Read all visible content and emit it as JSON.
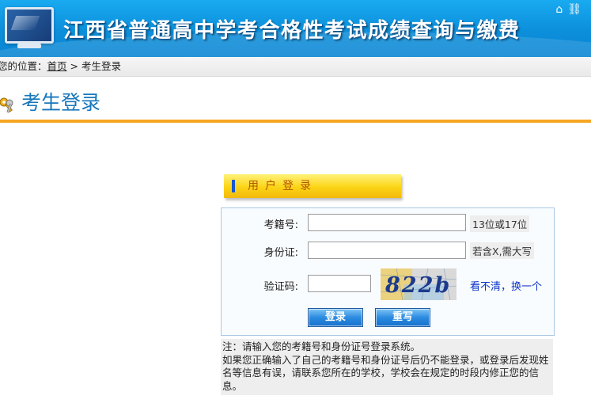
{
  "header": {
    "title": "江西省普通高中学考合格性考试成绩查询与缴费",
    "icons": [
      "house-icon",
      "link-icon"
    ]
  },
  "breadcrumb": {
    "label": "您的位置：",
    "home": "首页",
    "separator": " > ",
    "current": "考生登录"
  },
  "page": {
    "heading": "考生登录"
  },
  "login_tab": {
    "label": "用户登录"
  },
  "form": {
    "exam_id": {
      "label": "考籍号:",
      "value": "",
      "hint": "13位或17位"
    },
    "id_card": {
      "label": "身份证:",
      "value": "",
      "hint": "若含X,需大写"
    },
    "captcha": {
      "label": "验证码:",
      "value": "",
      "code": "822b",
      "refresh": "看不清，换一个"
    },
    "buttons": {
      "login": "登录",
      "reset": "重写"
    }
  },
  "note": {
    "line1": "注：请输入您的考籍号和身份证号登录系统。",
    "line2": "如果您正确输入了自己的考籍号和身份证号后仍不能登录，或登录后发现姓名等信息有误，请联系您所在的学校，学校会在规定的时段内修正您的信息。"
  },
  "colors": {
    "banner": "#0c8fdb",
    "heading_text": "#1777bb",
    "rule": "#f6a623",
    "tab": "#fbd415",
    "link": "#0b33c8"
  }
}
